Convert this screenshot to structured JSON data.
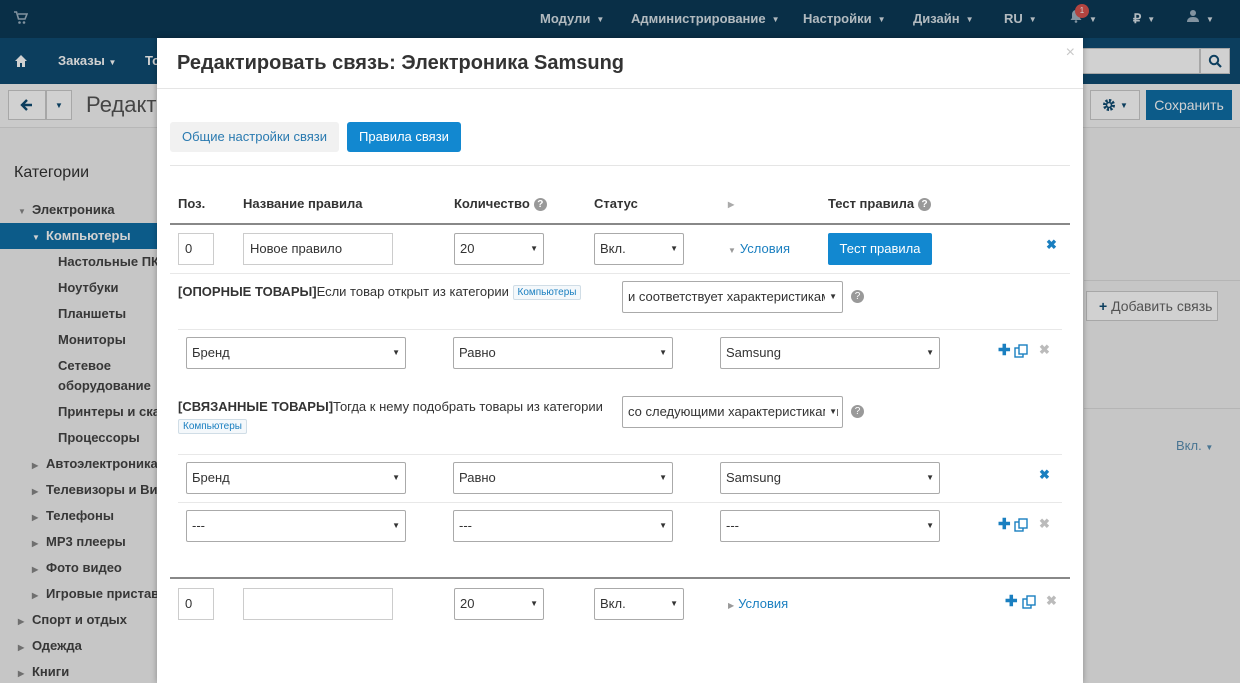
{
  "topbar": {
    "menus": [
      "Модули",
      "Администрирование",
      "Настройки",
      "Дизайн",
      "RU"
    ],
    "notifications_count": "1",
    "currency": "₽"
  },
  "navbar": {
    "orders_label": "Заказы",
    "truncated_item": "То"
  },
  "subbar": {
    "title_partial": "Редакт",
    "save_label": "Сохранить"
  },
  "sidebar": {
    "heading": "Категории",
    "items": [
      {
        "label": "Электроника"
      },
      {
        "label": "Компьютеры"
      },
      {
        "label": "Настольные ПК"
      },
      {
        "label": "Ноутбуки"
      },
      {
        "label": "Планшеты"
      },
      {
        "label": "Мониторы"
      },
      {
        "label": "Сетевое"
      },
      {
        "label": "оборудование"
      },
      {
        "label": "Принтеры и сканеры"
      },
      {
        "label": "Процессоры"
      },
      {
        "label": "Автоэлектроника"
      },
      {
        "label": "Телевизоры и Видео"
      },
      {
        "label": "Телефоны"
      },
      {
        "label": "MP3 плееры"
      },
      {
        "label": "Фото видео"
      },
      {
        "label": "Игровые приставки"
      },
      {
        "label": "Спорт и отдых"
      },
      {
        "label": "Одежда"
      },
      {
        "label": "Книги"
      }
    ]
  },
  "background": {
    "add_link_label": "Добавить связь",
    "status_filter": "Вкл."
  },
  "modal": {
    "title": "Редактировать связь: Электроника Samsung",
    "close": "×",
    "tabs": [
      {
        "label": "Общие настройки связи"
      },
      {
        "label": "Правила связи"
      }
    ],
    "columns": {
      "pos": "Поз.",
      "name": "Название правила",
      "qty": "Количество",
      "status": "Статус",
      "test": "Тест правила"
    },
    "rule1": {
      "pos": "0",
      "name": "Новое правило",
      "qty": "20",
      "status": "Вкл.",
      "conditions_label": "Условия",
      "test_button": "Тест правила",
      "base": {
        "label_bold": "[ОПОРНЫЕ ТОВАРЫ]",
        "label_text": "Если товар открыт из категории",
        "category_chip": "Компьютеры",
        "mode_select": "и соответствует характеристикам",
        "rows": [
          {
            "attr": "Бренд",
            "op": "Равно",
            "value": "Samsung"
          }
        ]
      },
      "related": {
        "label_bold": "[СВЯЗАННЫЕ ТОВАРЫ]",
        "label_text": "Тогда к нему подобрать товары из категории",
        "category_chip": "Компьютеры",
        "mode_select": "со следующими характеристиками",
        "rows": [
          {
            "attr": "Бренд",
            "op": "Равно",
            "value": "Samsung"
          },
          {
            "attr": "---",
            "op": "---",
            "value": "---"
          }
        ]
      }
    },
    "rule2": {
      "pos": "0",
      "name": "",
      "qty": "20",
      "status": "Вкл.",
      "conditions_label": "Условия"
    }
  }
}
